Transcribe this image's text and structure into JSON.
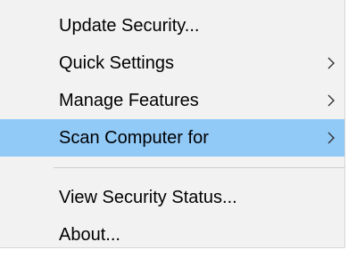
{
  "menu": {
    "items": [
      {
        "label": "Update Security...",
        "submenu": false,
        "highlighted": false
      },
      {
        "label": "Quick Settings",
        "submenu": true,
        "highlighted": false
      },
      {
        "label": "Manage Features",
        "submenu": true,
        "highlighted": false
      },
      {
        "label": "Scan Computer for",
        "submenu": true,
        "highlighted": true
      }
    ],
    "items_after_separator": [
      {
        "label": "View Security Status...",
        "submenu": false,
        "highlighted": false
      },
      {
        "label": "About...",
        "submenu": false,
        "highlighted": false
      }
    ],
    "submenu_arrow_icon": "chevron-right-icon"
  },
  "colors": {
    "menu_background": "#f2f2f2",
    "highlight": "#91c9f7",
    "text": "#000000",
    "separator": "#cfcfcf"
  }
}
